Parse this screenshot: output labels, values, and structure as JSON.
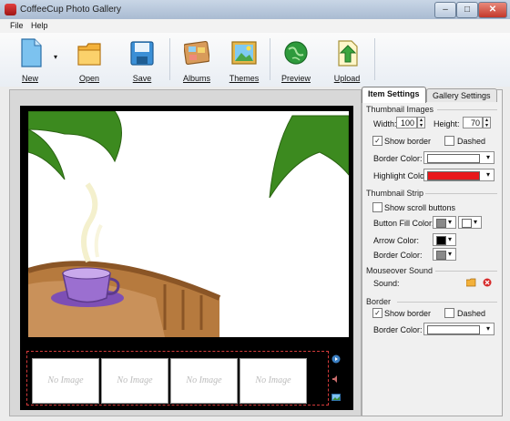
{
  "window": {
    "title": "CoffeeCup Photo Gallery",
    "minimize_glyph": "–",
    "maximize_glyph": "□",
    "close_glyph": "✕"
  },
  "menu": {
    "file": "File",
    "help": "Help"
  },
  "toolbar": {
    "new": "New",
    "new_dropdown_glyph": "▾",
    "open": "Open",
    "save": "Save",
    "albums": "Albums",
    "themes": "Themes",
    "preview": "Preview",
    "upload": "Upload"
  },
  "thumbnail_strip": {
    "thumbs": [
      "No Image",
      "No Image",
      "No Image",
      "No Image"
    ]
  },
  "panel": {
    "tabs": {
      "item_settings": "Item Settings",
      "gallery_settings": "Gallery Settings"
    },
    "thumbnail_images": {
      "heading": "Thumbnail Images",
      "width_label": "Width:",
      "width_value": "100",
      "height_label": "Height:",
      "height_value": "70",
      "show_border": "Show border",
      "show_border_checked": true,
      "dashed": "Dashed",
      "dashed_checked": false,
      "border_color_label": "Border Color:",
      "border_color": "#ffffff",
      "highlight_color_label": "Highlight Color:",
      "highlight_color": "#e8181b"
    },
    "thumbnail_strip": {
      "heading": "Thumbnail Strip",
      "show_scroll_buttons": "Show scroll buttons",
      "show_scroll_buttons_checked": false,
      "button_fill_color_label": "Button Fill Color:",
      "button_fill_color": "#8a8a8a",
      "button_fill_color_2": "#ffffff",
      "arrow_color_label": "Arrow Color:",
      "arrow_color": "#000000",
      "border_color_label": "Border Color:",
      "border_color": "#8a8a8a"
    },
    "mouseover_sound": {
      "heading": "Mouseover Sound",
      "sound_label": "Sound:"
    },
    "border": {
      "heading": "Border",
      "show_border": "Show border",
      "show_border_checked": true,
      "dashed": "Dashed",
      "dashed_checked": false,
      "border_color_label": "Border Color:",
      "border_color": "#ffffff"
    }
  },
  "check_glyph": "✓",
  "dropdown_glyph": "▾",
  "spin_up_glyph": "▴",
  "spin_down_glyph": "▾"
}
